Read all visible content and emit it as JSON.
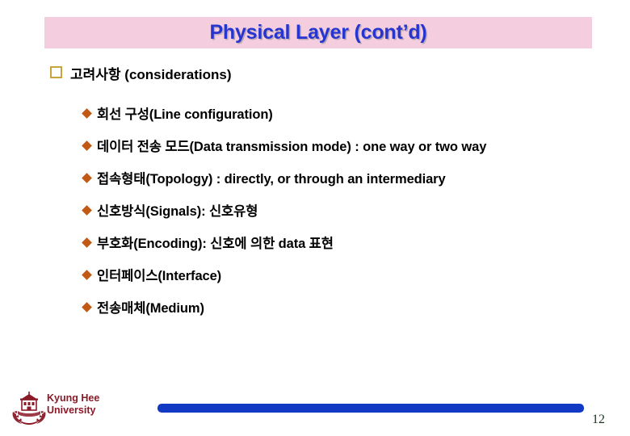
{
  "slide": {
    "title": "Physical Layer (cont’d)",
    "title_bg_color": "#f4cede",
    "title_text_color": "#2635cf",
    "heading": {
      "marker": "square-outline-bullet",
      "text": "고려사항 (considerations)"
    },
    "bullets": [
      {
        "marker": "diamond-bullet",
        "text": "회선 구성(Line configuration)"
      },
      {
        "marker": "diamond-bullet",
        "text": "데이터 전송 모드(Data transmission mode) : one way or two way"
      },
      {
        "marker": "diamond-bullet",
        "text": "접속형태(Topology) : directly, or through an intermediary"
      },
      {
        "marker": "diamond-bullet",
        "text": "신호방식(Signals): 신호유형"
      },
      {
        "marker": "diamond-bullet",
        "text": "부호화(Encoding): 신호에 의한 data 표현"
      },
      {
        "marker": "diamond-bullet",
        "text": "인터페이스(Interface)"
      },
      {
        "marker": "diamond-bullet",
        "text": "전송매체(Medium)"
      }
    ]
  },
  "footer": {
    "logo_name": "kyung-hee-university-crest",
    "university": "Kyung Hee\nUniversity",
    "university_color": "#8b1a28",
    "bar_color": "#1239c4",
    "page_number": "12",
    "page_number_color": "#1d3321"
  }
}
